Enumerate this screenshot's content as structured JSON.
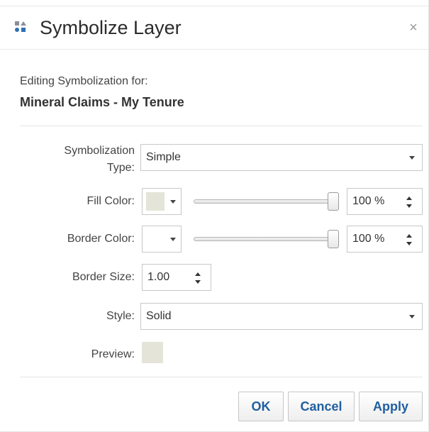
{
  "dialog": {
    "title": "Symbolize Layer",
    "close_symbol": "×",
    "title_icon": "symbolize-icon"
  },
  "layer": {
    "editing_label": "Editing Symbolization for:",
    "name": "Mineral Claims - My Tenure"
  },
  "form": {
    "symbolization_type": {
      "label_line1": "Symbolization",
      "label_line2": "Type:",
      "value": "Simple"
    },
    "fill_color": {
      "label": "Fill Color:",
      "color": "#e4e4d8",
      "opacity_percent": 100,
      "opacity_text": "100 %"
    },
    "border_color": {
      "label": "Border Color:",
      "color": "#ffffff",
      "opacity_percent": 100,
      "opacity_text": "100 %"
    },
    "border_size": {
      "label": "Border Size:",
      "value": "1.00"
    },
    "style": {
      "label": "Style:",
      "value": "Solid"
    },
    "preview": {
      "label": "Preview:",
      "color": "#e4e4d8"
    }
  },
  "buttons": {
    "ok": "OK",
    "cancel": "Cancel",
    "apply": "Apply"
  },
  "colors": {
    "accent_text": "#1f5f9f",
    "border": "#c8c8c8"
  }
}
